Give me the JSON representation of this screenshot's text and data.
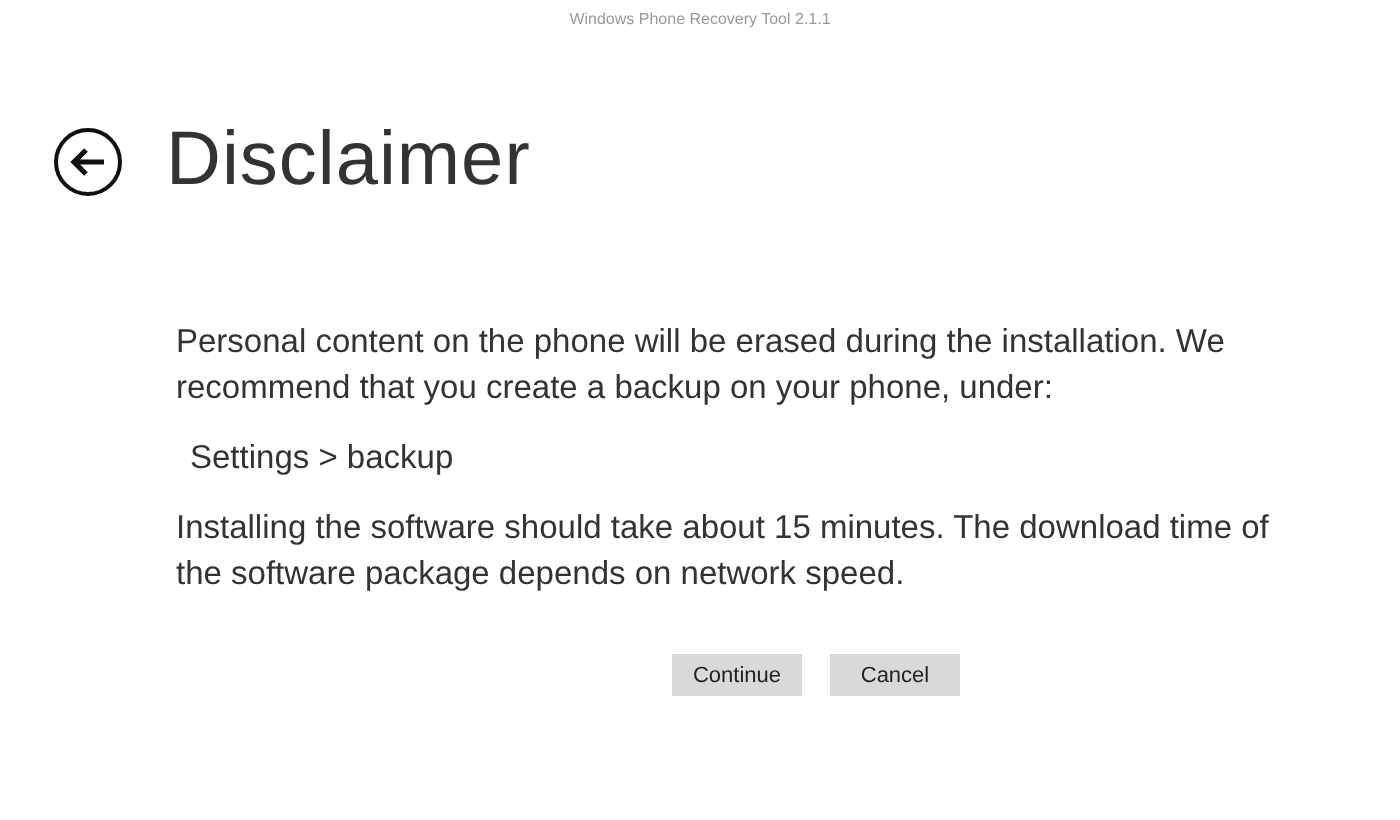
{
  "window": {
    "title": "Windows Phone Recovery Tool 2.1.1"
  },
  "page": {
    "title": "Disclaimer"
  },
  "paragraphs": [
    {
      "kind": "text",
      "text": "Personal content on the phone will be erased during the installation. We recommend that you create a backup on your phone, under:"
    },
    {
      "kind": "path",
      "text": "Settings > backup"
    },
    {
      "kind": "text",
      "text": "Installing the software should take about 15 minutes. The download time of the software package depends on network speed."
    }
  ],
  "buttons": [
    "Continue",
    "Cancel"
  ]
}
